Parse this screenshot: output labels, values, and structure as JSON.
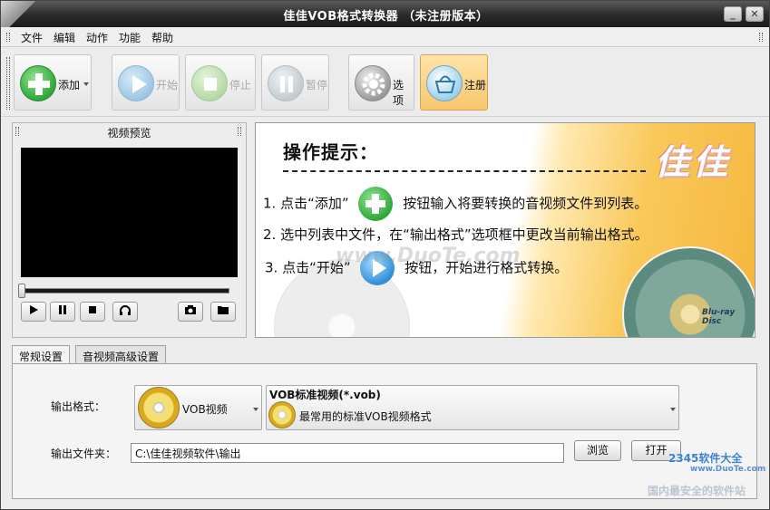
{
  "window": {
    "title": "佳佳VOB格式转换器  （未注册版本）",
    "minimize_glyph": "_",
    "close_glyph": "✕"
  },
  "menu": {
    "items": [
      "文件",
      "编辑",
      "动作",
      "功能",
      "帮助"
    ]
  },
  "toolbar": {
    "add_label": "添加",
    "start_label": "开始",
    "stop_label": "停止",
    "pause_label": "暂停",
    "options_label": "选项",
    "register_label": "注册"
  },
  "preview": {
    "title": "视频预览"
  },
  "tips": {
    "title": "操作提示：",
    "step1_before": "1. 点击“添加”",
    "step1_after": "按钮输入将要转换的音视频文件到列表。",
    "step2": "2. 选中列表中文件，在“输出格式”选项框中更改当前输出格式。",
    "step3_before": "3. 点击“开始”",
    "step3_after": "按钮，开始进行格式转换。",
    "brand_logo": "佳佳",
    "watermark": "www.DuoTe.com",
    "disc_label": "Blu-ray Disc"
  },
  "tabs": {
    "general": "常规设置",
    "advanced": "音视频高级设置"
  },
  "settings": {
    "output_format_label": "输出格式：",
    "format_category": "VOB视频",
    "format_name": "VOB标准视频(*.vob)",
    "format_desc": "最常用的标准VOB视频格式",
    "output_folder_label": "输出文件夹：",
    "output_folder_value": "C:\\佳佳视频软件\\输出",
    "browse_label": "浏览",
    "open_label": "打开"
  },
  "watermarks": {
    "site_brand": "2345软件大全",
    "site_url": "www.DuoTe.com",
    "site_slogan": "国内最安全的软件站"
  },
  "colors": {
    "titlebar": "#2a2a2a",
    "register_button": "#f7c56c",
    "add_icon": "#3bb54a",
    "play_icon": "#2f8fd8",
    "tips_gradient": "#f5b73c"
  }
}
